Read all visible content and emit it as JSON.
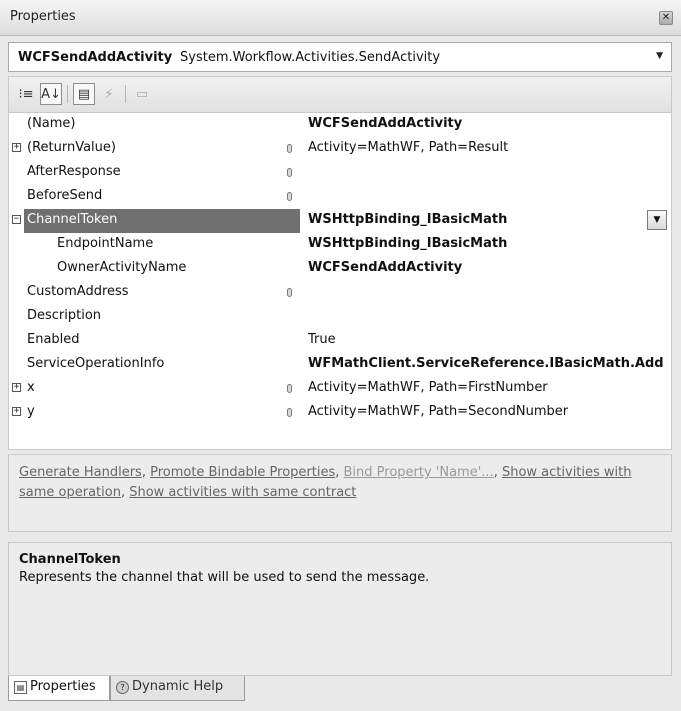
{
  "window": {
    "title": "Properties"
  },
  "selector": {
    "name": "WCFSendAddActivity",
    "type": "System.Workflow.Activities.SendActivity"
  },
  "toolbar": {
    "buttons": [
      {
        "icon": "categorized-icon",
        "glyph": "⁝≡"
      },
      {
        "icon": "alphabetical-icon",
        "glyph": "A↓"
      },
      {
        "icon": "properties-icon",
        "glyph": "▤"
      },
      {
        "icon": "events-icon",
        "glyph": "⚡"
      },
      {
        "icon": "property-pages-icon",
        "glyph": "▭"
      }
    ]
  },
  "properties": [
    {
      "name": "(Name)",
      "value": "WCFSendAddActivity"
    },
    {
      "name": "(ReturnValue)",
      "value": "Activity=MathWF, Path=Result"
    },
    {
      "name": "AfterResponse",
      "value": ""
    },
    {
      "name": "BeforeSend",
      "value": ""
    },
    {
      "name": "ChannelToken",
      "value": "WSHttpBinding_IBasicMath"
    },
    {
      "name": "EndpointName",
      "value": "WSHttpBinding_IBasicMath"
    },
    {
      "name": "OwnerActivityName",
      "value": "WCFSendAddActivity"
    },
    {
      "name": "CustomAddress",
      "value": ""
    },
    {
      "name": "Description",
      "value": ""
    },
    {
      "name": "Enabled",
      "value": "True"
    },
    {
      "name": "ServiceOperationInfo",
      "value": "WFMathClient.ServiceReference.IBasicMath.Add"
    },
    {
      "name": "x",
      "value": "Activity=MathWF, Path=FirstNumber"
    },
    {
      "name": "y",
      "value": "Activity=MathWF, Path=SecondNumber"
    }
  ],
  "expanders": {
    "plus": "+",
    "minus": "−"
  },
  "dropdown_glyph": "▼",
  "commands": [
    {
      "label": "Generate Handlers",
      "sep": ", "
    },
    {
      "label": "Promote Bindable Properties",
      "sep": ", "
    },
    {
      "label": "Bind Property 'Name'...",
      "sep": ", "
    },
    {
      "label": "Show activities with same operation",
      "sep": ", "
    },
    {
      "label": "Show activities with same contract",
      "sep": ""
    }
  ],
  "description": {
    "title": "ChannelToken",
    "text": "Represents the  channel that will be used to send the message."
  },
  "tabs": [
    {
      "label": "Properties",
      "icon": "properties-tab-icon"
    },
    {
      "label": "Dynamic Help",
      "icon": "help-icon"
    }
  ],
  "colors": {
    "selected_row": "#6f6f6f",
    "background": "#e9e9e9"
  }
}
